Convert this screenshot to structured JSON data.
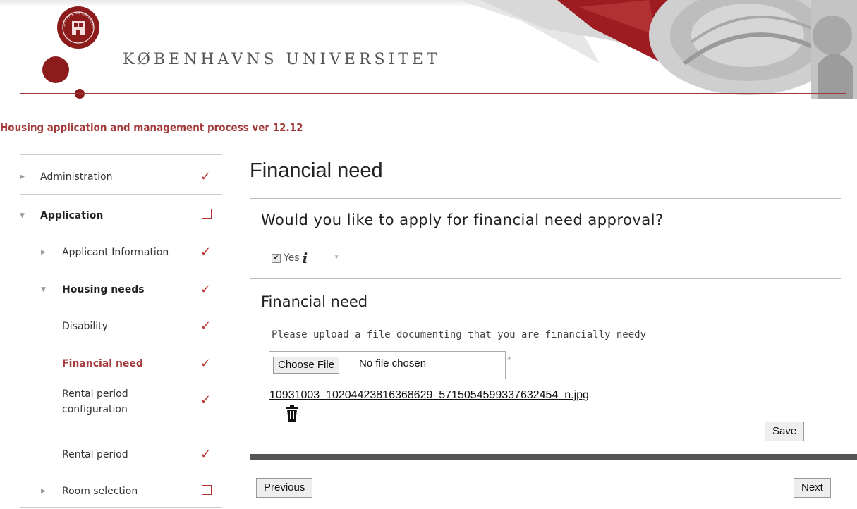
{
  "header": {
    "university_name": "KØBENHAVNS UNIVERSITET",
    "seal_text": "UNIVERSITAS HAUNIENSIS SIGILLUM"
  },
  "process_title": "Housing application and management process ver 12.12",
  "sidebar": {
    "items": [
      {
        "label": "Administration",
        "status": "done"
      },
      {
        "label": "Application",
        "status": "incomplete"
      },
      {
        "label": "Applicant Information",
        "status": "done"
      },
      {
        "label": "Housing needs",
        "status": "done"
      },
      {
        "label": "Disability",
        "status": "done"
      },
      {
        "label": "Financial need",
        "status": "done",
        "active": true
      },
      {
        "label": "Rental period configuration",
        "status": "done"
      },
      {
        "label": "Rental period",
        "status": "done"
      },
      {
        "label": "Room selection",
        "status": "incomplete"
      }
    ],
    "check_glyph": "✓"
  },
  "main": {
    "title": "Financial need",
    "question": "Would you like to apply for financial need approval?",
    "yes_label": "Yes",
    "info_glyph": "i",
    "required_mark": "*",
    "section_title": "Financial need",
    "upload_instruction": "Please upload a file documenting that you are financially needy",
    "choose_file_label": "Choose File",
    "no_file_text": "No file chosen",
    "uploaded_file": "10931003_10204423816368629_5715054599337632454_n.jpg",
    "save_label": "Save",
    "previous_label": "Previous",
    "next_label": "Next"
  },
  "colors": {
    "accent": "#a33a3a",
    "check": "#b8312f",
    "brand_dark": "#8c1c1c"
  }
}
